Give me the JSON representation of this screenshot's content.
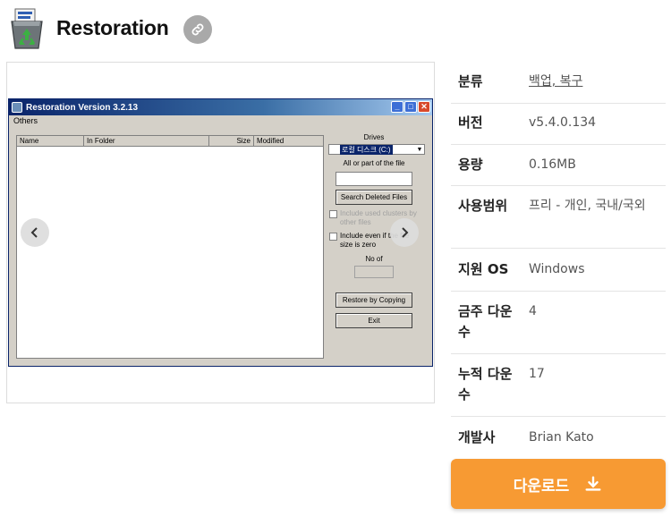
{
  "header": {
    "title": "Restoration",
    "app_icon": "recycle-bin-icon",
    "link_icon": "link-icon"
  },
  "screenshot": {
    "window_title": "Restoration Version 3.2.13",
    "menu": [
      "Others"
    ],
    "columns": [
      "Name",
      "In Folder",
      "Size",
      "Modified"
    ],
    "drives_label": "Drives",
    "drive_selected": "로컬 디스크 (C:)",
    "filter_label": "All or part of the file",
    "search_button": "Search Deleted Files",
    "option1": "Include used clusters by other files",
    "option2": "Include even if the file size is zero",
    "no_of_label": "No of",
    "restore_button": "Restore by Copying",
    "exit_button": "Exit",
    "prev_icon": "chevron-left-icon",
    "next_icon": "chevron-right-icon"
  },
  "info": {
    "category": {
      "label": "분류",
      "value": "백업, 복구"
    },
    "version": {
      "label": "버전",
      "value": "v5.4.0.134"
    },
    "size": {
      "label": "용량",
      "value": "0.16MB"
    },
    "license": {
      "label": "사용범위",
      "value": "프리 - 개인, 국내/국외"
    },
    "os": {
      "label": "지원 OS",
      "value": "Windows"
    },
    "weekly": {
      "label": "금주 다운수",
      "value": "4"
    },
    "total": {
      "label": "누적 다운수",
      "value": "17"
    },
    "developer": {
      "label": "개발사",
      "value": "Brian Kato"
    }
  },
  "download": {
    "label": "다운로드",
    "icon": "download-icon"
  },
  "colors": {
    "accent": "#f79a33",
    "link_bg": "#a9a9a9"
  }
}
